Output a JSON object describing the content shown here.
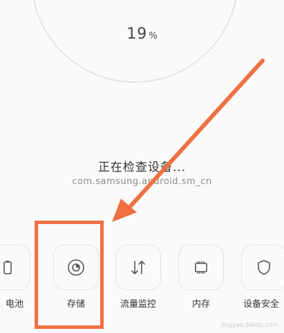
{
  "scan": {
    "percent_value": "19",
    "percent_unit": "%",
    "status_title": "正在检查设备...",
    "status_subtitle": "com.samsung.android.sm_cn"
  },
  "tiles": [
    {
      "label": "电池",
      "icon": "battery-icon"
    },
    {
      "label": "存储",
      "icon": "storage-icon"
    },
    {
      "label": "流量监控",
      "icon": "data-usage-icon"
    },
    {
      "label": "内存",
      "icon": "memory-chip-icon"
    },
    {
      "label": "设备安全",
      "icon": "shield-icon"
    }
  ],
  "annotation": {
    "arrow_color": "#f07043",
    "highlight_color": "#f07043"
  },
  "watermark": "jingyan.baidu.com"
}
